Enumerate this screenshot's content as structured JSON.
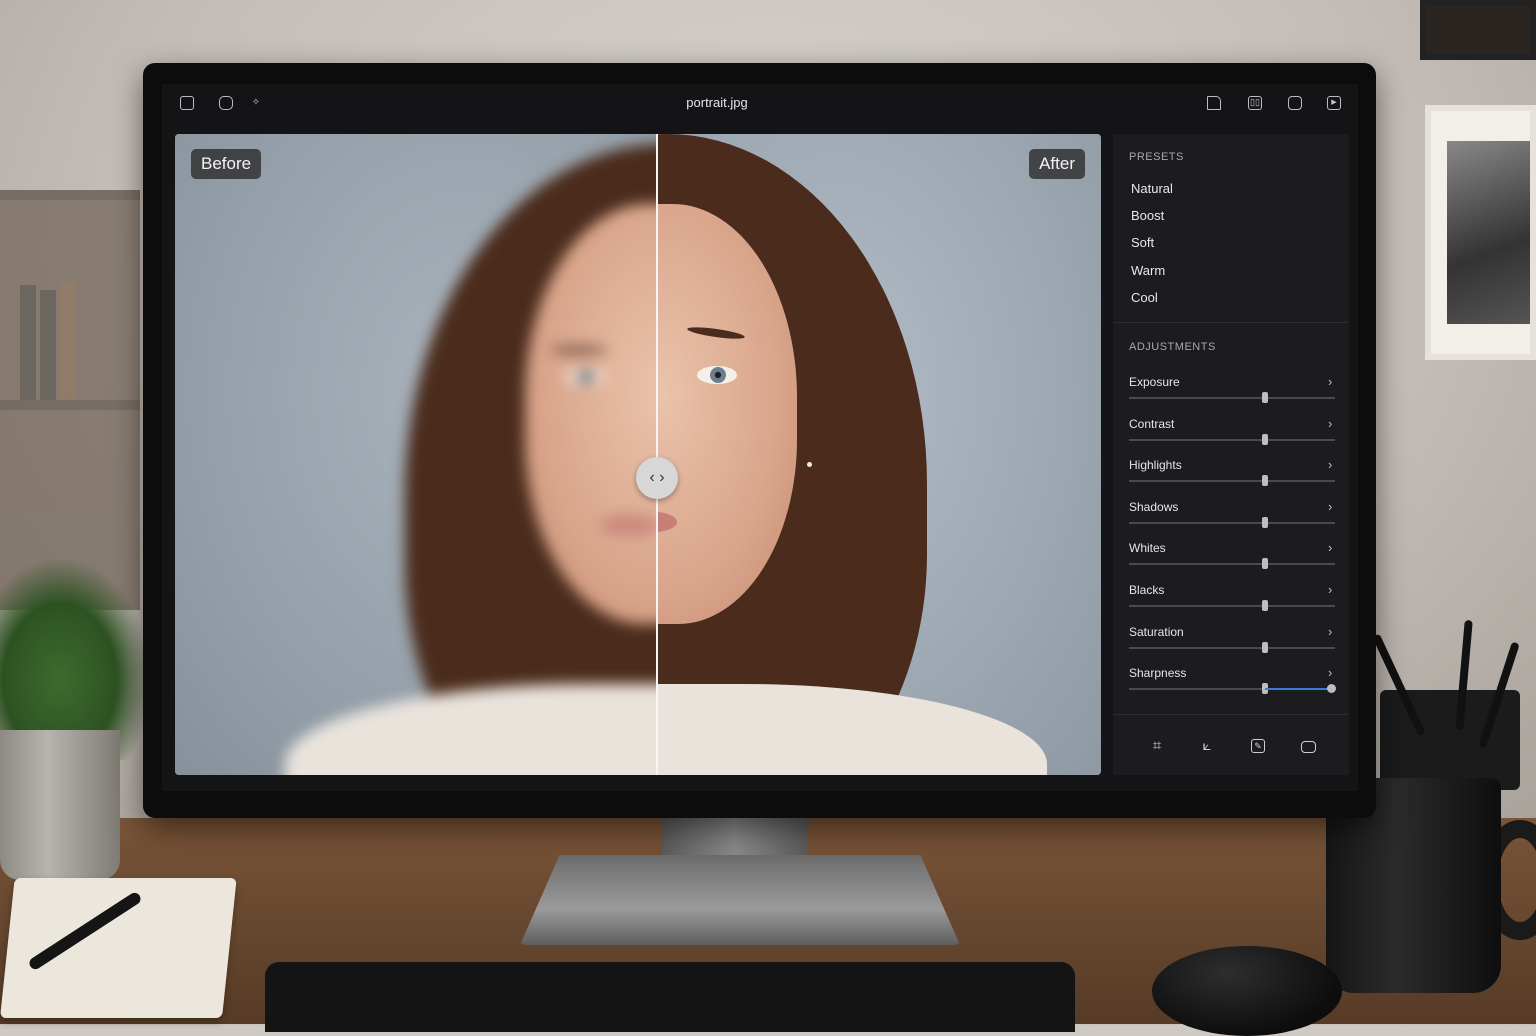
{
  "window": {
    "title": "portrait.jpg"
  },
  "canvas": {
    "before_label": "Before",
    "after_label": "After",
    "split_position": 0.52
  },
  "presets": {
    "title": "PRESETS",
    "items": [
      "Natural",
      "Boost",
      "Soft",
      "Warm",
      "Cool"
    ]
  },
  "adjustments": {
    "title": "ADJUSTMENTS",
    "items": [
      {
        "label": "Exposure",
        "value": 0.66
      },
      {
        "label": "Contrast",
        "value": 0.66
      },
      {
        "label": "Highlights",
        "value": 0.66
      },
      {
        "label": "Shadows",
        "value": 0.66
      },
      {
        "label": "Whites",
        "value": 0.66
      },
      {
        "label": "Blacks",
        "value": 0.66
      },
      {
        "label": "Saturation",
        "value": 0.66
      },
      {
        "label": "Sharpness",
        "value": 0.66,
        "max": 0.98
      }
    ]
  },
  "toolbar": {
    "left_icons": [
      "square-icon",
      "rounded-square-icon",
      "sparkle-icon"
    ],
    "right_icons": [
      "file-icon",
      "compare-icon",
      "window-icon",
      "export-icon"
    ],
    "bottom_tools": [
      "crop-icon",
      "transform-icon",
      "edit-icon",
      "frame-icon"
    ]
  },
  "colors": {
    "accent": "#3a7bd5",
    "panel": "#1c1c1e",
    "screen": "#141416"
  }
}
